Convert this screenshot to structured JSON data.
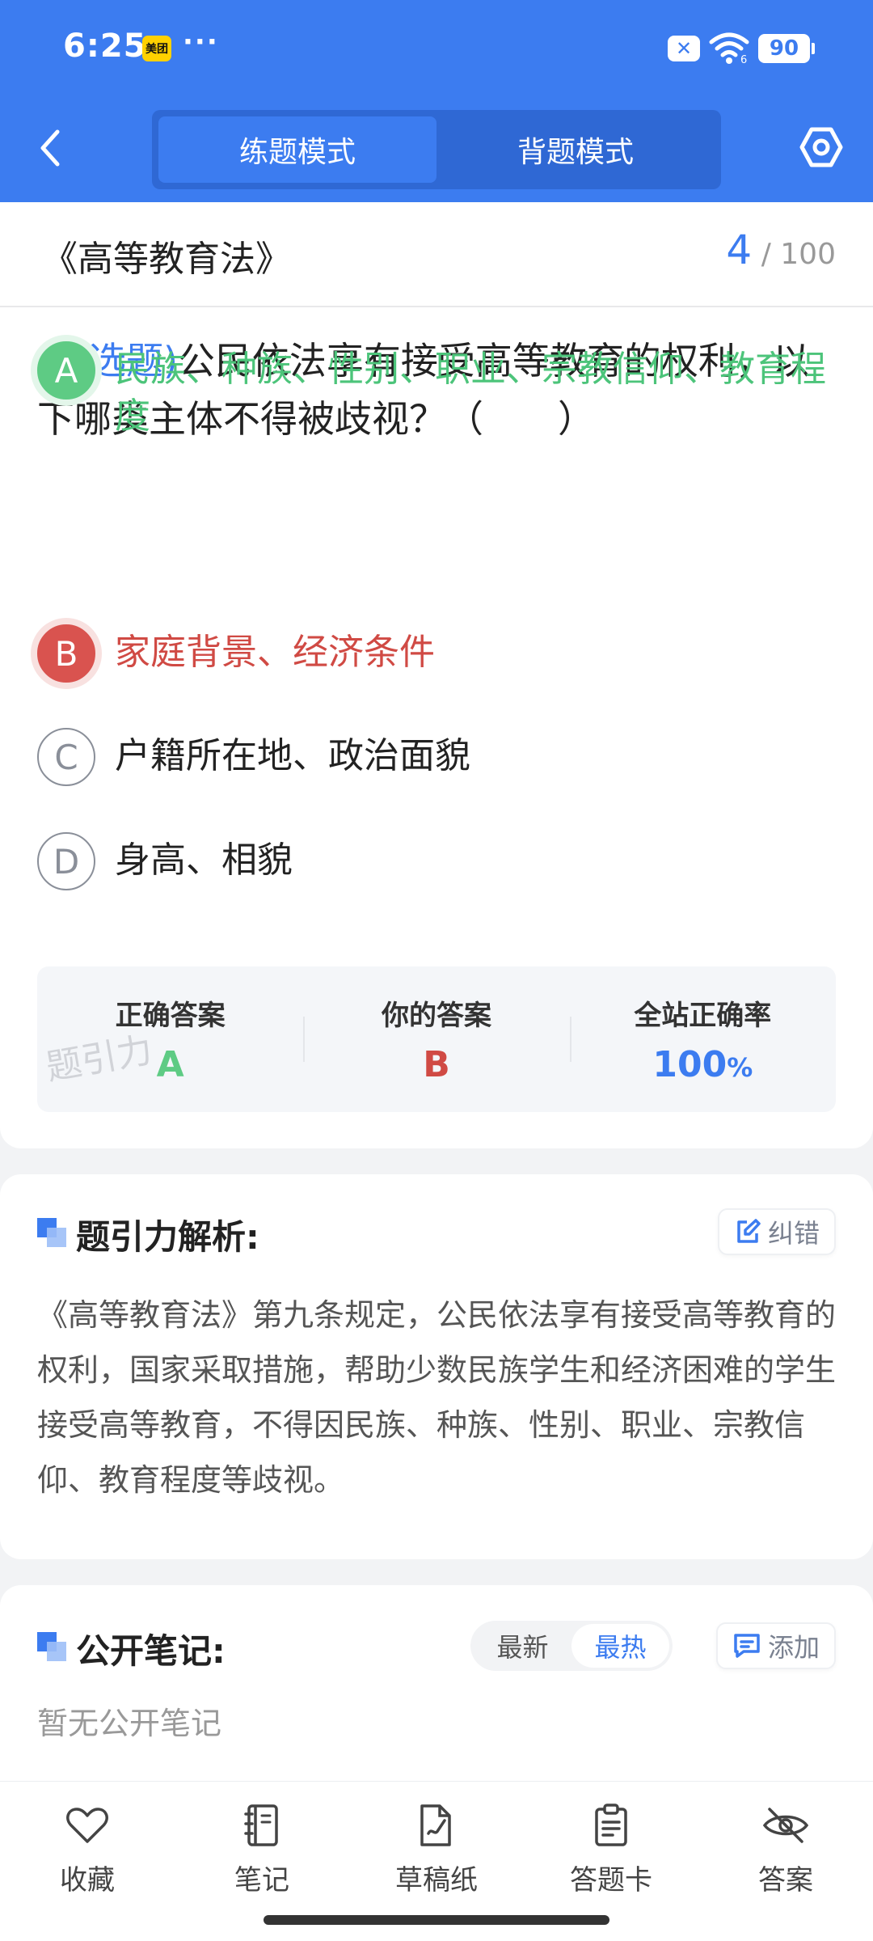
{
  "status_bar": {
    "time": "6:25",
    "app_badge": "美团",
    "more_dots": "···",
    "battery": "90"
  },
  "header": {
    "tabs": [
      {
        "label": "练题模式",
        "active": true
      },
      {
        "label": "背题模式",
        "active": false
      }
    ],
    "accent": "#3c7cf0"
  },
  "question_card": {
    "book_title": "《高等教育法》",
    "counter_current": "4",
    "counter_sep": "/",
    "counter_total": "100",
    "question_type": "(单选题)",
    "question_text": "公民依法享有接受高等教育的权利，以下哪类主体不得被歧视？（　　）",
    "options": [
      {
        "letter": "A",
        "text": "民族、种族、性别、职业、宗教信仰、教育程度",
        "state": "correct"
      },
      {
        "letter": "B",
        "text": "家庭背景、经济条件",
        "state": "wrong"
      },
      {
        "letter": "C",
        "text": "户籍所在地、政治面貌",
        "state": "none"
      },
      {
        "letter": "D",
        "text": "身高、相貌",
        "state": "none"
      }
    ],
    "answer_summary": {
      "correct_label": "正确答案",
      "correct_value": "A",
      "yours_label": "你的答案",
      "yours_value": "B",
      "rate_label": "全站正确率",
      "rate_value": "100",
      "rate_unit": "%"
    },
    "watermark": "题引力"
  },
  "analysis": {
    "title": "题引力解析:",
    "correct_button": "纠错",
    "text": "《高等教育法》第九条规定，公民依法享有接受高等教育的权利，国家采取措施，帮助少数民族学生和经济困难的学生接受高等教育，不得因民族、种族、性别、职业、宗教信仰、教育程度等歧视。"
  },
  "notes": {
    "title": "公开笔记:",
    "sort_tabs": [
      {
        "label": "最新",
        "active": false
      },
      {
        "label": "最热",
        "active": true
      }
    ],
    "add_button": "添加",
    "empty_text": "暂无公开笔记"
  },
  "bottom_bar": [
    {
      "label": "收藏",
      "icon": "heart-icon"
    },
    {
      "label": "笔记",
      "icon": "notebook-icon"
    },
    {
      "label": "草稿纸",
      "icon": "draft-icon"
    },
    {
      "label": "答题卡",
      "icon": "clipboard-icon"
    },
    {
      "label": "答案",
      "icon": "eye-off-icon"
    }
  ]
}
